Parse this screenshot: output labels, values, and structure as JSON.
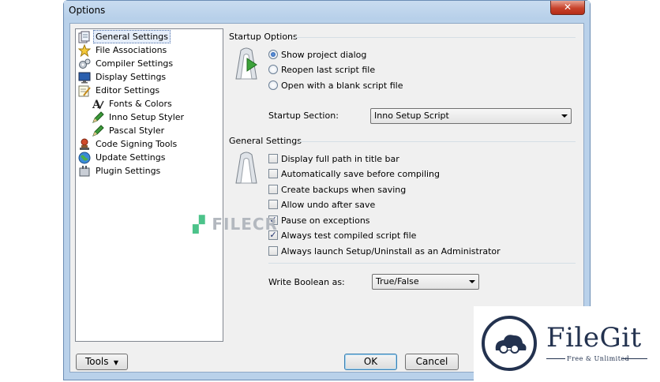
{
  "window": {
    "title": "Options",
    "close_glyph": "✕"
  },
  "tree": {
    "items": [
      {
        "label": "General Settings",
        "icon": "pages-icon",
        "indent": 0,
        "selected": true
      },
      {
        "label": "File Associations",
        "icon": "star-icon",
        "indent": 0
      },
      {
        "label": "Compiler Settings",
        "icon": "gears-icon",
        "indent": 0
      },
      {
        "label": "Display Settings",
        "icon": "monitor-icon",
        "indent": 0
      },
      {
        "label": "Editor Settings",
        "icon": "editor-icon",
        "indent": 0
      },
      {
        "label": "Fonts & Colors",
        "icon": "fonts-icon",
        "indent": 1
      },
      {
        "label": "Inno Setup Styler",
        "icon": "pencil-icon",
        "indent": 1
      },
      {
        "label": "Pascal Styler",
        "icon": "pencil-icon",
        "indent": 1
      },
      {
        "label": "Code Signing Tools",
        "icon": "stamp-icon",
        "indent": 0
      },
      {
        "label": "Update Settings",
        "icon": "globe-icon",
        "indent": 0
      },
      {
        "label": "Plugin Settings",
        "icon": "plugin-icon",
        "indent": 0
      }
    ]
  },
  "startup": {
    "title": "Startup Options",
    "radios": [
      {
        "label": "Show project dialog",
        "checked": true
      },
      {
        "label": "Reopen last script file",
        "checked": false
      },
      {
        "label": "Open with a blank script file",
        "checked": false
      }
    ],
    "section_label": "Startup Section:",
    "section_value": "Inno Setup Script"
  },
  "general": {
    "title": "General Settings",
    "checks": [
      {
        "label": "Display full path in title bar",
        "checked": false
      },
      {
        "label": "Automatically save before compiling",
        "checked": false
      },
      {
        "label": "Create backups when saving",
        "checked": false
      },
      {
        "label": "Allow undo after save",
        "checked": false
      },
      {
        "label": "Pause on exceptions",
        "checked": true
      },
      {
        "label": "Always test compiled script file",
        "checked": true
      },
      {
        "label": "Always launch Setup/Uninstall as an Administrator",
        "checked": false
      }
    ],
    "boolean_label": "Write Boolean as:",
    "boolean_value": "True/False"
  },
  "buttons": {
    "tools": "Tools",
    "ok": "OK",
    "cancel": "Cancel"
  },
  "watermarks": {
    "filecr": "FILECR",
    "filegit_name": "FileGit",
    "filegit_tag": "Free & Unlimited"
  },
  "colors": {
    "title_bar": "#b9d1ea",
    "client": "#f0f0f0",
    "close": "#c7422b",
    "brand": "#23324f"
  }
}
